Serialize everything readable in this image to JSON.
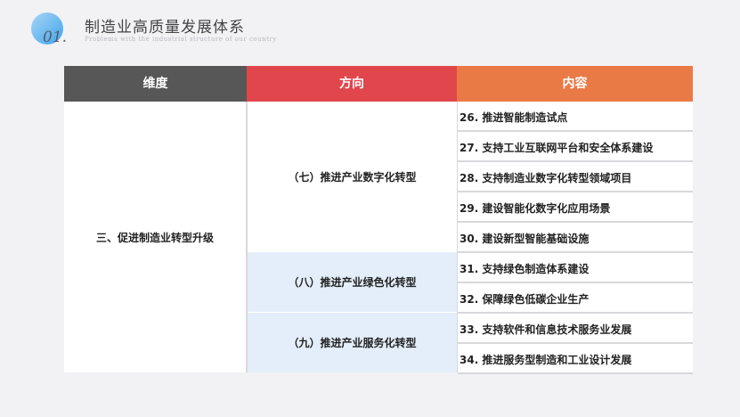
{
  "header": {
    "number": "01.",
    "title": "制造业高质量发展体系",
    "subtitle": "Problems with the industrial structure of our country"
  },
  "table": {
    "columns": [
      "维度",
      "方向",
      "内容"
    ],
    "dimension": "三、促进制造业转型升级",
    "directions": [
      "（七）推进产业数字化转型",
      "（八）推进产业绿色化转型",
      "（九）推进产业服务化转型"
    ],
    "items": [
      "26. 推进智能制造试点",
      "27. 支持工业互联网平台和安全体系建设",
      "28. 支持制造业数字化转型领域项目",
      "29. 建设智能化数字化应用场景",
      "30. 建设新型智能基础设施",
      "31. 支持绿色制造体系建设",
      "32. 保障绿色低碳企业生产",
      "33. 支持软件和信息技术服务业发展",
      "34. 推进服务型制造和工业设计发展"
    ]
  },
  "colors": {
    "header_dim": "#575757",
    "header_dir": "#e0464b",
    "header_content": "#ea7a45",
    "highlight": "#e3eefa"
  }
}
